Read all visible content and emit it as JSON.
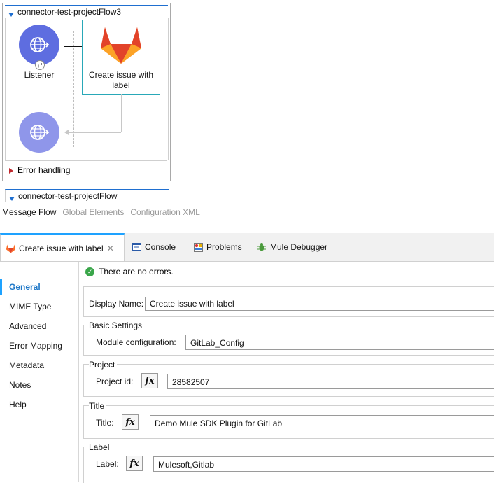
{
  "flow": {
    "title": "connector-test-projectFlow3",
    "listener_label": "Listener",
    "operation_label": "Create issue with label",
    "error_handling": "Error handling",
    "second_flow_title": "connector-test-projectFlow"
  },
  "editor_tabs": [
    {
      "label": "Message Flow",
      "active": true
    },
    {
      "label": "Global Elements",
      "active": false
    },
    {
      "label": "Configuration XML",
      "active": false
    }
  ],
  "view_tabs": [
    {
      "label": "Create issue with label",
      "active": true,
      "icon": "gitlab-icon"
    },
    {
      "label": "Console",
      "active": false,
      "icon": "console-icon"
    },
    {
      "label": "Problems",
      "active": false,
      "icon": "problems-icon"
    },
    {
      "label": "Mule Debugger",
      "active": false,
      "icon": "debugger-icon"
    }
  ],
  "nav": [
    {
      "label": "General",
      "active": true
    },
    {
      "label": "MIME Type",
      "active": false
    },
    {
      "label": "Advanced",
      "active": false
    },
    {
      "label": "Error Mapping",
      "active": false
    },
    {
      "label": "Metadata",
      "active": false
    },
    {
      "label": "Notes",
      "active": false
    },
    {
      "label": "Help",
      "active": false
    }
  ],
  "status": {
    "text": "There are no errors."
  },
  "form": {
    "display_name": {
      "label": "Display Name:",
      "value": "Create issue with label"
    },
    "basic_settings": {
      "title": "Basic Settings",
      "module_config": {
        "label": "Module configuration:",
        "value": "GitLab_Config"
      }
    },
    "project": {
      "title": "Project",
      "project_id": {
        "label": "Project id:",
        "value": "28582507"
      }
    },
    "title_section": {
      "title": "Title",
      "title_field": {
        "label": "Title:",
        "value": "Demo Mule SDK Plugin for GitLab"
      }
    },
    "label_section": {
      "title": "Label",
      "label_field": {
        "label": "Label:",
        "value": "Mulesoft,Gitlab"
      }
    },
    "fx_label": "fx"
  },
  "colors": {
    "accent": "#1ea2ff",
    "listener": "#5e6de0",
    "gitlab_orange": "#fc6d26",
    "gitlab_red": "#e24329",
    "ok": "#3aa64a"
  }
}
